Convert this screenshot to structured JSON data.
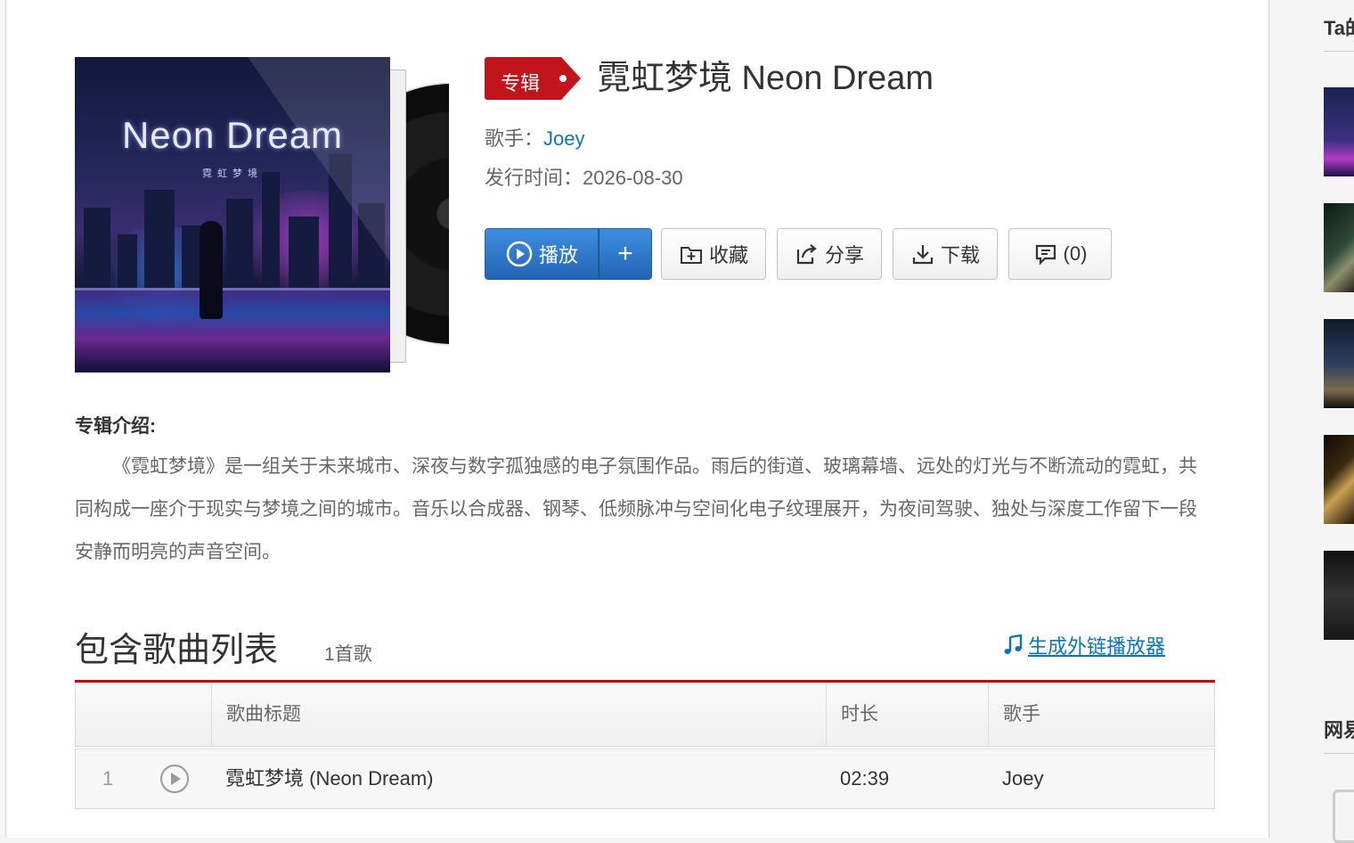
{
  "album": {
    "tag": "专辑",
    "title": "霓虹梦境 Neon Dream",
    "artist_label": "歌手：",
    "artist": "Joey",
    "date_label": "发行时间：",
    "date": "2026-08-30",
    "cover_title": "Neon Dream",
    "cover_subtitle": "霓虹梦境"
  },
  "buttons": {
    "play": "播放",
    "add": "+",
    "favorite": "收藏",
    "share": "分享",
    "download": "下载",
    "comment": "(0)"
  },
  "description": {
    "title": "专辑介绍:",
    "text": "《霓虹梦境》是一组关于未来城市、深夜与数字孤独感的电子氛围作品。雨后的街道、玻璃幕墙、远处的灯光与不断流动的霓虹，共同构成一座介于现实与梦境之间的城市。音乐以合成器、钢琴、低频脉冲与空间化电子纹理展开，为夜间驾驶、独处与深度工作留下一段安静而明亮的声音空间。"
  },
  "songlist": {
    "title": "包含歌曲列表",
    "count": "1首歌",
    "outchain": "生成外链播放器",
    "headers": {
      "title": "歌曲标题",
      "duration": "时长",
      "artist": "歌手"
    },
    "rows": [
      {
        "index": "1",
        "title": "霓虹梦境 (Neon Dream)",
        "duration": "02:39",
        "artist": "Joey"
      }
    ]
  },
  "sidebar": {
    "heading": "Ta的",
    "heading2": "网易"
  },
  "colors": {
    "accent_red": "#c20c0c",
    "link_blue": "#0c73c2",
    "play_blue": "#2f7cd0"
  }
}
